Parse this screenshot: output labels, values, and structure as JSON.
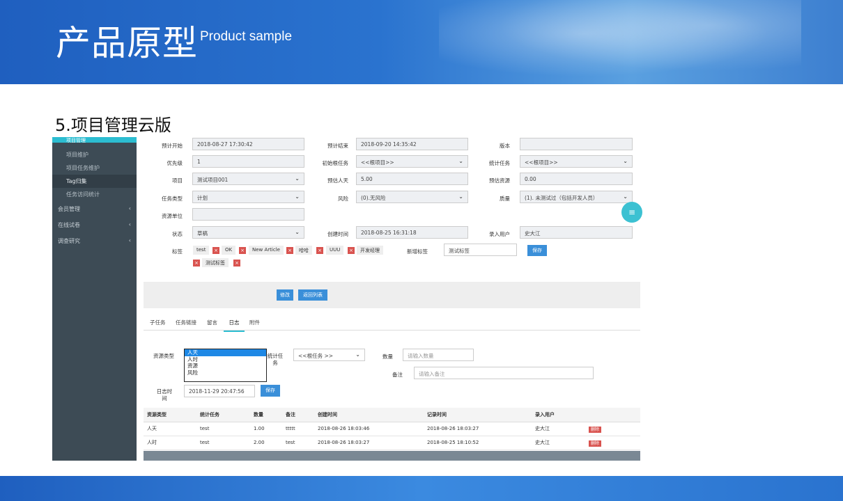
{
  "slide": {
    "title": "产品原型",
    "subtitle": "Product sample",
    "section": "5.项目管理云版"
  },
  "sidebar": {
    "top": "项目管理",
    "subitems": [
      "项目维护",
      "项目任务维护",
      "Tag归集",
      "任务访问统计"
    ],
    "main": [
      "会员管理",
      "在线试卷",
      "调查研究"
    ]
  },
  "form": {
    "r1": {
      "l1": "预计开始",
      "v1": "2018-08-27 17:30:42",
      "l2": "预计结束",
      "v2": "2018-09-20 14:35:42",
      "l3": "版本",
      "v3": ""
    },
    "r2": {
      "l1": "优先级",
      "v1": "1",
      "l2": "初始根任务",
      "v2": "<<根项目>>",
      "l3": "统计任务",
      "v3": "<<根项目>>"
    },
    "r3": {
      "l1": "项目",
      "v1": "测试项目001",
      "l2": "预估人天",
      "v2": "5.00",
      "l3": "预估资源",
      "v3": "0.00"
    },
    "r4": {
      "l1": "任务类型",
      "v1": "计划",
      "l2": "风险",
      "v2": "(0).无风险",
      "l3": "质量",
      "v3": "(1). 未测试过（包括开发人员）"
    },
    "r5": {
      "l1": "资源单位",
      "v1": ""
    },
    "r6": {
      "l1": "状态",
      "v1": "草稿",
      "l2": "创建时间",
      "v2": "2018-08-25 16:31:18",
      "l3": "录入用户",
      "v3": "史大江"
    },
    "tags_label": "标签",
    "tags": [
      "test",
      "OK",
      "New Article",
      "哈哈",
      "UUU",
      "开发经理",
      "测试标签"
    ],
    "new_tag_label": "新增标签",
    "new_tag_value": "测试标签",
    "save": "保存",
    "modify": "修改",
    "back": "返回列表"
  },
  "tabs": [
    "子任务",
    "任务链接",
    "留言",
    "日志",
    "附件"
  ],
  "log": {
    "res_type_label": "资源类型",
    "options": [
      "人天",
      "人时",
      "资源",
      "风险"
    ],
    "stat_label": "统计任务",
    "stat_value": "<<根任务 >>",
    "qty_label": "数量",
    "qty_placeholder": "请输入数量",
    "note_label": "备注",
    "note_placeholder": "请输入备注",
    "time_label": "日志时间",
    "time_value": "2018-11-29 20:47:56",
    "save": "保存"
  },
  "table": {
    "headers": [
      "资源类型",
      "统计任务",
      "数量",
      "备注",
      "创建时间",
      "记录时间",
      "录入用户",
      ""
    ],
    "rows": [
      [
        "人天",
        "test",
        "1.00",
        "ttttt",
        "2018-08-26 18:03:46",
        "2018-08-26 18:03:27",
        "史大江",
        "删除"
      ],
      [
        "人时",
        "test",
        "2.00",
        "test",
        "2018-08-26 18:03:27",
        "2018-08-25 18:10:52",
        "史大江",
        "删除"
      ]
    ]
  },
  "fab_icon": "menu-icon"
}
